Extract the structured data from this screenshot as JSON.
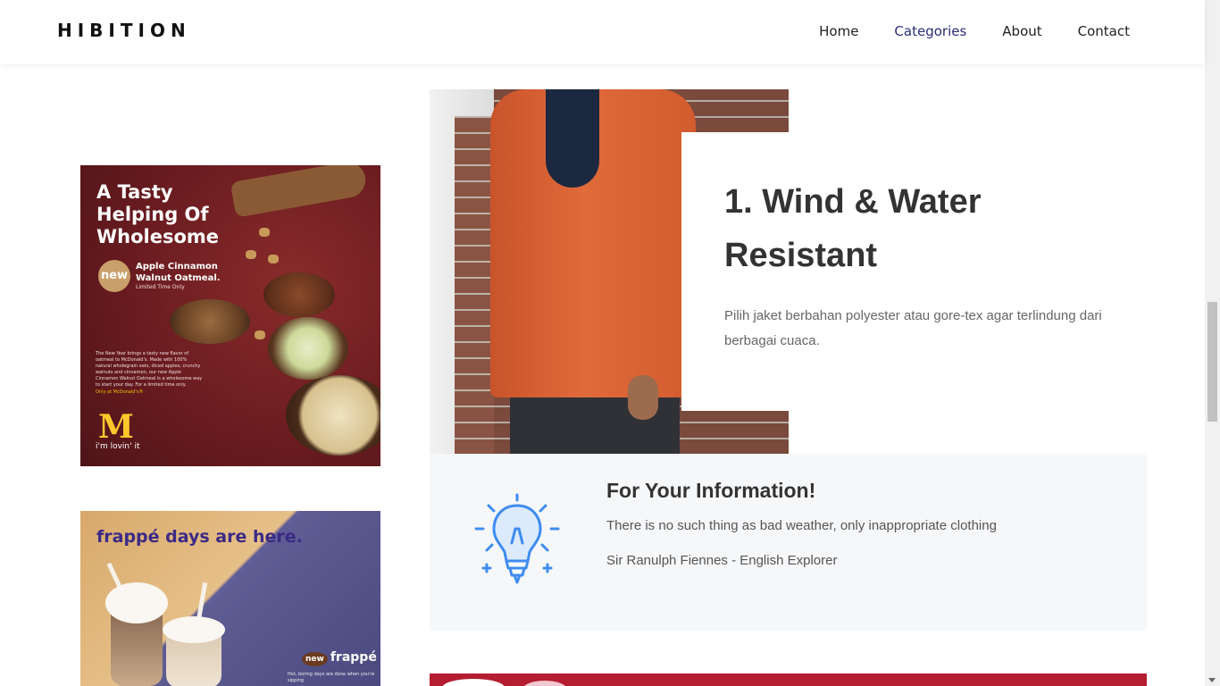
{
  "header": {
    "brand": "HIBITION",
    "nav": [
      {
        "label": "Home",
        "active": false
      },
      {
        "label": "Categories",
        "active": true
      },
      {
        "label": "About",
        "active": false
      },
      {
        "label": "Contact",
        "active": false
      }
    ],
    "active_color": "#2c2c7a"
  },
  "ads": {
    "oatmeal": {
      "headline": [
        "A Tasty",
        "Helping Of",
        "Wholesome"
      ],
      "badge": "new",
      "product": [
        "Apple Cinnamon",
        "Walnut Oatmeal."
      ],
      "limited": "Limited Time Only",
      "body": "The New Year brings a tasty new flavor of oatmeal to McDonald's. Made with 100% natural wholegrain oats, diced apples, crunchy walnuts and cinnamon, our new Apple Cinnamon Walnut Oatmeal is a wholesome way to start your day. For a limited time only.",
      "link": "Only at McDonald's®",
      "logo": "M",
      "tagline": "i'm lovin' it"
    },
    "frappe": {
      "headline": "frappé days are here.",
      "badge": "new",
      "logo": "frappé",
      "small_text": "Hot, boring days are done when you're sipping"
    }
  },
  "feature": {
    "title": "1. Wind & Water Resistant",
    "description": "Pilih jaket berbahan polyester atau gore-tex agar terlindung dari berbagai cuaca."
  },
  "info": {
    "icon": "lightbulb-icon",
    "icon_color": "#3f8cf0",
    "title": "For Your Information!",
    "quote": "There is no such thing as bad weather, only inappropriate clothing",
    "author": "Sir Ranulph Fiennes - English Explorer"
  }
}
